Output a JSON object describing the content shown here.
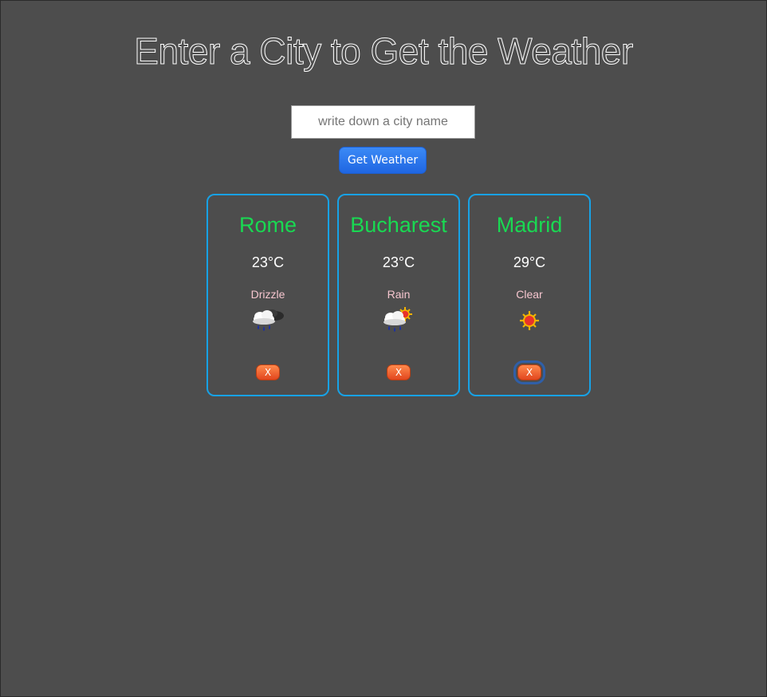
{
  "page": {
    "title": "Enter a City to Get the Weather"
  },
  "search": {
    "placeholder": "write down a city name",
    "value": "",
    "button_label": "Get Weather"
  },
  "cards": [
    {
      "city": "Rome",
      "temp": "23°C",
      "description": "Drizzle",
      "icon": "drizzle-cloud-icon",
      "remove_label": "X"
    },
    {
      "city": "Bucharest",
      "temp": "23°C",
      "description": "Rain",
      "icon": "rain-sun-icon",
      "remove_label": "X"
    },
    {
      "city": "Madrid",
      "temp": "29°C",
      "description": "Clear",
      "icon": "sun-icon",
      "remove_label": "X"
    }
  ],
  "colors": {
    "background": "#4d4d4d",
    "card_border": "#17a2e6",
    "city_name": "#19d952",
    "description": "#f6c6cf",
    "button": "#1f66e2",
    "remove_button": "#e2461e"
  }
}
